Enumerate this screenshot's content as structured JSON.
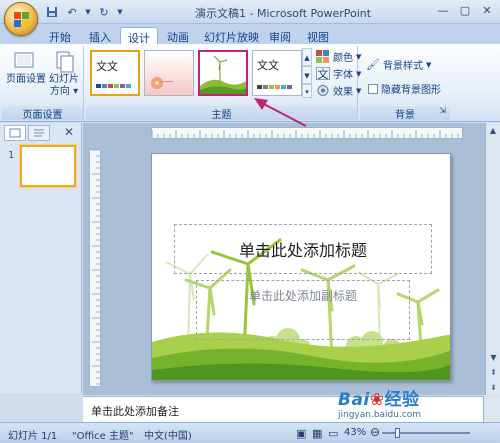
{
  "window": {
    "title": "演示文稿1 - Microsoft PowerPoint"
  },
  "tabs": [
    {
      "label": "开始",
      "active": false
    },
    {
      "label": "插入",
      "active": false
    },
    {
      "label": "设计",
      "active": true
    },
    {
      "label": "动画",
      "active": false
    },
    {
      "label": "幻灯片放映",
      "active": false
    },
    {
      "label": "审阅",
      "active": false
    },
    {
      "label": "视图",
      "active": false
    }
  ],
  "ribbon": {
    "page_setup_group": {
      "label": "页面设置",
      "page_setup_button": "页面设置",
      "orientation_button_line1": "幻灯片",
      "orientation_button_line2": "方向"
    },
    "themes_group": {
      "label": "主题",
      "themes": [
        {
          "name": "Office 主题",
          "text": "文文",
          "selected": true
        },
        {
          "name": "flower",
          "text": "",
          "selected": false
        },
        {
          "name": "green wind",
          "text": "",
          "selected": false,
          "highlighted": true
        },
        {
          "name": "plain",
          "text": "文文",
          "selected": false
        }
      ],
      "colors_label": "颜色",
      "fonts_label": "字体",
      "effects_label": "效果"
    },
    "background_group": {
      "label": "背景",
      "background_styles": "背景样式",
      "hide_background": "隐藏背景图形"
    }
  },
  "slide": {
    "title_placeholder": "单击此处添加标题",
    "subtitle_placeholder": "单击此处添加副标题"
  },
  "notes": {
    "placeholder": "单击此处添加备注"
  },
  "status": {
    "slide_counter": "幻灯片 1/1",
    "theme": "\"Office 主题\"",
    "language": "中文(中国)",
    "zoom": "43%",
    "zoom_level": 0.43
  },
  "thumbnail": {
    "number": "1"
  },
  "watermark": {
    "brand": "Bai",
    "brand_suffix": "经验",
    "url": "jingyan.baidu.com"
  },
  "colors": {
    "accent_selected": "#e3a21a",
    "annotation": "#c0247a",
    "ribbon_text": "#15428b"
  }
}
